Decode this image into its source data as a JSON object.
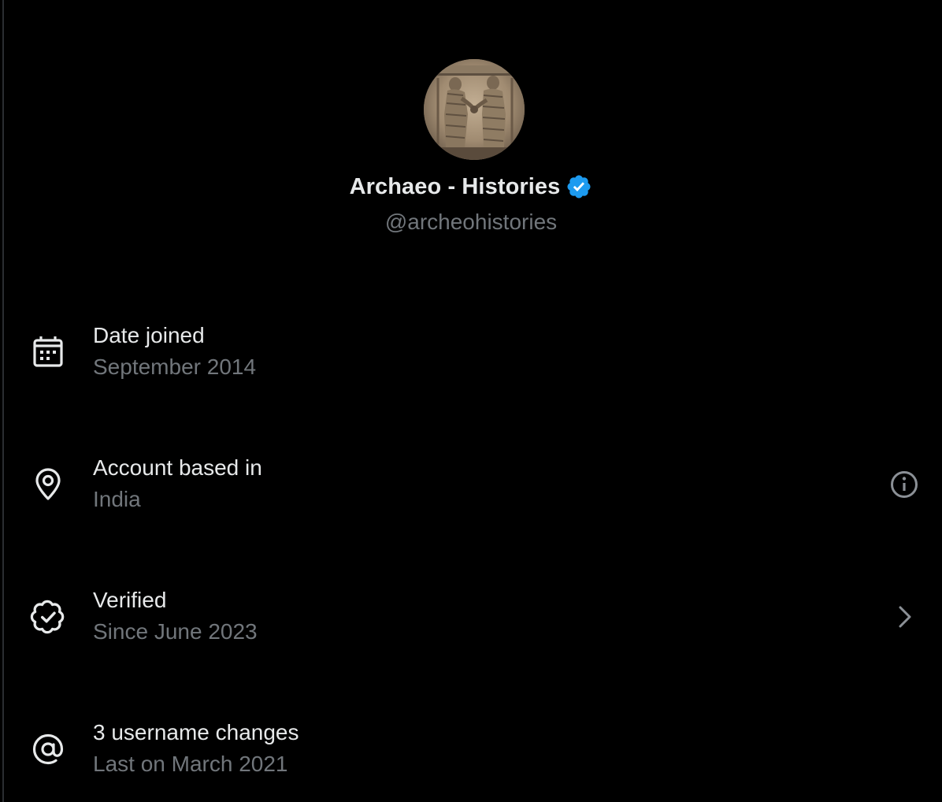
{
  "profile": {
    "display_name": "Archaeo - Histories",
    "handle": "@archeohistories",
    "verified_icon": "verified-badge-icon",
    "badge_color": "#1d9bf0"
  },
  "rows": [
    {
      "icon": "calendar-icon",
      "title": "Date joined",
      "subtitle": "September 2014",
      "right_icon": null
    },
    {
      "icon": "location-pin-icon",
      "title": "Account based in",
      "subtitle": "India",
      "right_icon": "info-icon"
    },
    {
      "icon": "verified-check-icon",
      "title": "Verified",
      "subtitle": "Since June 2023",
      "right_icon": "chevron-right-icon"
    },
    {
      "icon": "at-sign-icon",
      "title": "3 username changes",
      "subtitle": "Last on March 2021",
      "right_icon": null
    }
  ],
  "colors": {
    "background": "#000000",
    "primary_text": "#e7e9ea",
    "secondary_text": "#71767b",
    "accent": "#1d9bf0"
  }
}
